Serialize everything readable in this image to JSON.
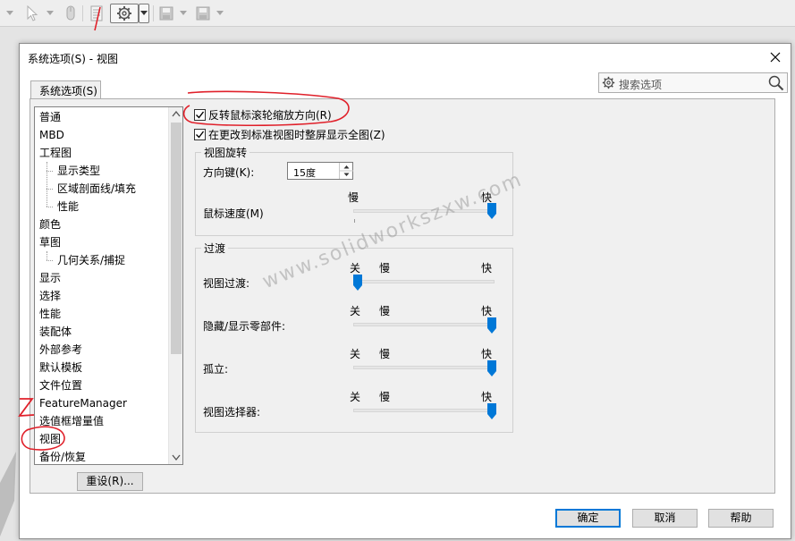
{
  "toolbar": {
    "icons": [
      "dropdown-arrow-icon",
      "select-pointer-icon",
      "mouse-icon",
      "document-properties-icon",
      "options-gear-icon",
      "save-icon",
      "save-as-icon"
    ]
  },
  "dialog": {
    "title": "系统选项(S) - 视图",
    "tab_label": "系统选项(S)",
    "search_placeholder": "搜索选项"
  },
  "tree": {
    "items": [
      {
        "label": "普通",
        "child": false
      },
      {
        "label": "MBD",
        "child": false
      },
      {
        "label": "工程图",
        "child": false
      },
      {
        "label": "显示类型",
        "child": true
      },
      {
        "label": "区域剖面线/填充",
        "child": true
      },
      {
        "label": "性能",
        "child": true
      },
      {
        "label": "颜色",
        "child": false
      },
      {
        "label": "草图",
        "child": false
      },
      {
        "label": "几何关系/捕捉",
        "child": true
      },
      {
        "label": "显示",
        "child": false
      },
      {
        "label": "选择",
        "child": false
      },
      {
        "label": "性能",
        "child": false
      },
      {
        "label": "装配体",
        "child": false
      },
      {
        "label": "外部参考",
        "child": false
      },
      {
        "label": "默认模板",
        "child": false
      },
      {
        "label": "文件位置",
        "child": false
      },
      {
        "label": "FeatureManager",
        "child": false
      },
      {
        "label": "选值框增量值",
        "child": false
      },
      {
        "label": "视图",
        "child": false,
        "selected": true
      },
      {
        "label": "备份/恢复",
        "child": false
      }
    ]
  },
  "reset_button": "重设(R)...",
  "options": {
    "reverse_wheel": {
      "label": "反转鼠标滚轮缩放方向(R)",
      "checked": true
    },
    "zoom_to_fit": {
      "label": "在更改到标准视图时整屏显示全图(Z)",
      "checked": true
    }
  },
  "view_rotation": {
    "title": "视图旋转",
    "arrow_keys_label": "方向键(K):",
    "arrow_keys_value": "15度",
    "mouse_speed_label": "鼠标速度(M)",
    "slow": "慢",
    "fast": "快",
    "mouse_speed_level": 1.0
  },
  "transitions": {
    "title": "过渡",
    "off": "关",
    "slow": "慢",
    "fast": "快",
    "rows": [
      {
        "label": "视图过渡:",
        "level": 0.0
      },
      {
        "label": "隐藏/显示零部件:",
        "level": 1.0
      },
      {
        "label": "孤立:",
        "level": 1.0
      },
      {
        "label": "视图选择器:",
        "level": 1.0
      }
    ]
  },
  "buttons": {
    "ok": "确定",
    "cancel": "取消",
    "help": "帮助"
  },
  "annotations": {
    "watermark": "www.solidworkszxw.com",
    "marks": [
      "1",
      "2"
    ]
  },
  "colors": {
    "accent": "#0078d7",
    "annotation": "#e0202a"
  }
}
